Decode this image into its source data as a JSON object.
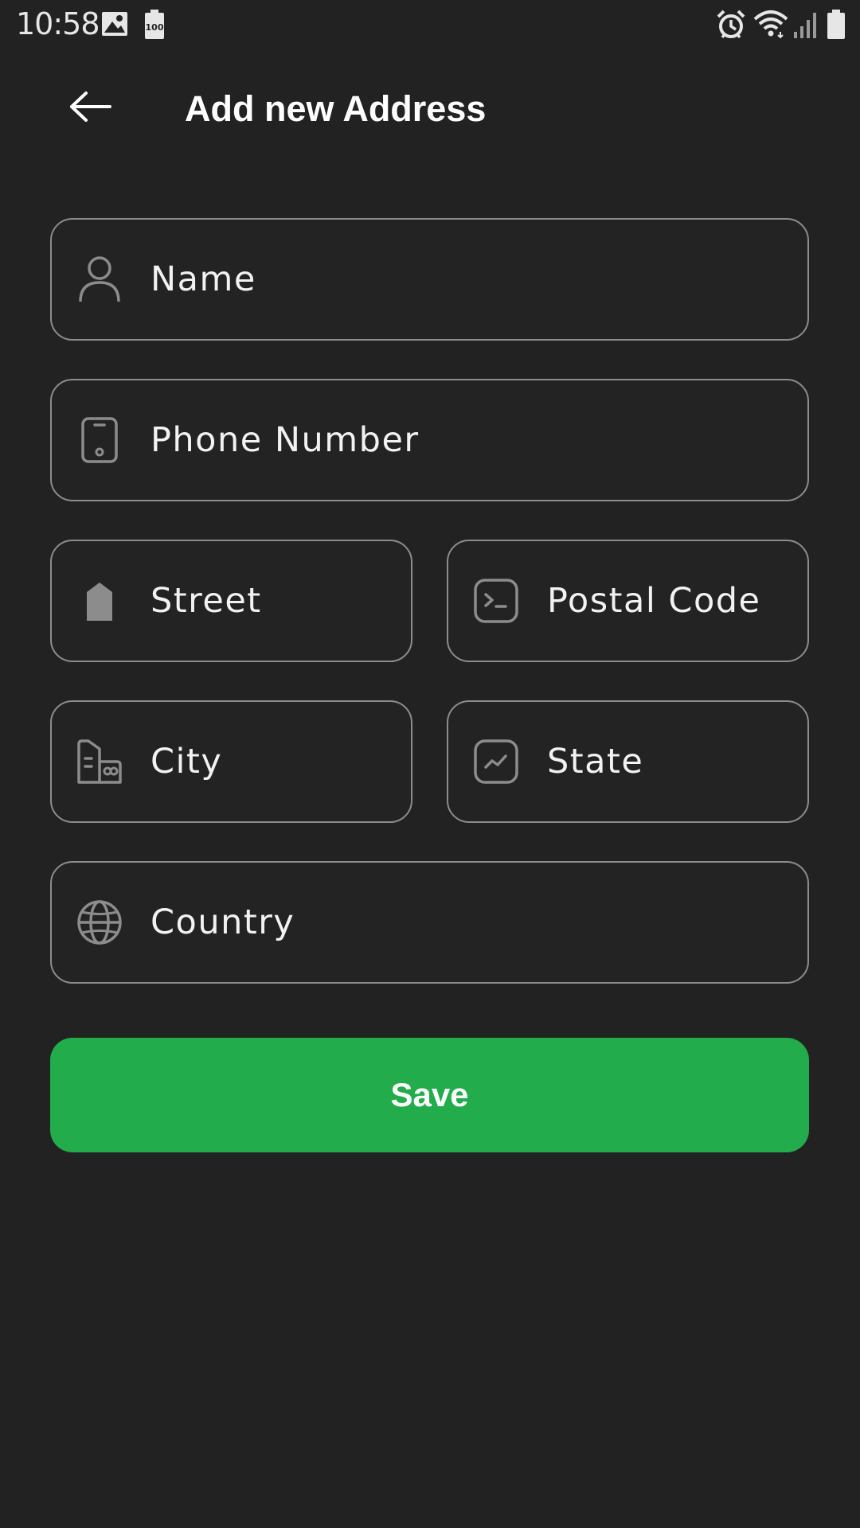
{
  "status_bar": {
    "time": "10:58",
    "icons": [
      "image-icon",
      "battery-100-icon",
      "alarm-icon",
      "wifi-icon",
      "signal-icon",
      "battery-icon"
    ],
    "battery_small_label": "100"
  },
  "header": {
    "back_icon": "arrow-left-icon",
    "title": "Add new Address"
  },
  "form": {
    "fields": [
      {
        "id": "name",
        "placeholder": "Name",
        "value": "",
        "icon": "person-icon"
      },
      {
        "id": "phone",
        "placeholder": "Phone Number",
        "value": "",
        "icon": "phone-icon"
      },
      {
        "id": "street",
        "placeholder": "Street",
        "value": "",
        "icon": "street-marker-icon"
      },
      {
        "id": "postal",
        "placeholder": "Postal Code",
        "value": "",
        "icon": "terminal-icon"
      },
      {
        "id": "city",
        "placeholder": "City",
        "value": "",
        "icon": "city-buildings-icon"
      },
      {
        "id": "state",
        "placeholder": "State",
        "value": "",
        "icon": "chart-line-icon"
      },
      {
        "id": "country",
        "placeholder": "Country",
        "value": "",
        "icon": "globe-icon"
      }
    ]
  },
  "save_button": {
    "label": "Save",
    "color": "#23ac4b"
  },
  "colors": {
    "background": "#222222",
    "field_border": "#8c8c8c",
    "icon": "#8c8c8c",
    "text": "#f2f2f2"
  }
}
